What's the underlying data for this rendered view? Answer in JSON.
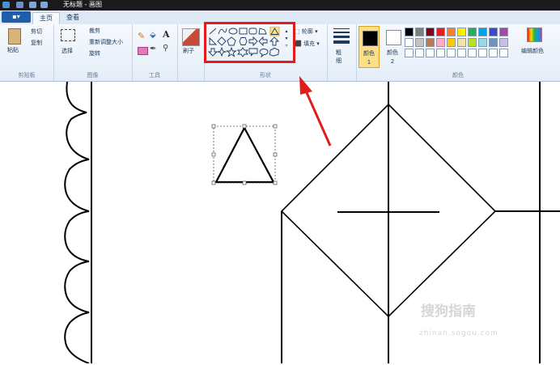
{
  "window": {
    "title": "无标题 - 画图"
  },
  "tabs": {
    "file_label": "",
    "home": "主页",
    "view": "查看"
  },
  "clipboard": {
    "paste": "粘贴",
    "cut": "剪切",
    "copy": "复制",
    "group": "剪贴板"
  },
  "image": {
    "select": "选择",
    "crop": "裁剪",
    "resize": "重新调整大小",
    "rotate": "旋转",
    "group": "图像"
  },
  "tools": {
    "group": "工具"
  },
  "brush": {
    "label": "刷子"
  },
  "shapes": {
    "outline": "轮廓",
    "fill": "填充",
    "group": "形状"
  },
  "size": {
    "label": "粗细"
  },
  "colors": {
    "color1": "颜色 1",
    "color2": "颜色 2",
    "edit": "编辑颜色",
    "group": "颜色",
    "palette_row1": [
      "#000000",
      "#7f7f7f",
      "#880015",
      "#ed1c24",
      "#ff7f27",
      "#fff200",
      "#22b14c",
      "#00a2e8",
      "#3f48cc",
      "#a349a4"
    ],
    "palette_row2": [
      "#ffffff",
      "#c3c3c3",
      "#b97a57",
      "#ffaec9",
      "#ffc90e",
      "#efe4b0",
      "#b5e61d",
      "#99d9ea",
      "#7092be",
      "#c8bfe7"
    ]
  },
  "watermark": {
    "main": "搜狗指南",
    "sub": "zhinan.sogou.com"
  }
}
